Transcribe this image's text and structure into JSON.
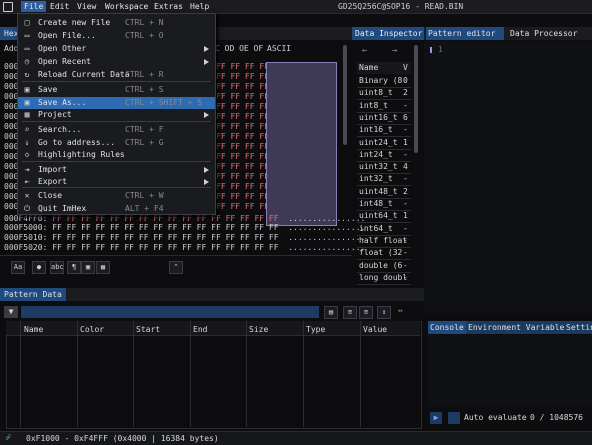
{
  "menubar": {
    "items": [
      "File",
      "Edit",
      "View",
      "Workspace",
      "Extras",
      "Help"
    ],
    "title": "GD25Q256C@SOP16 - READ.BIN"
  },
  "file_menu": [
    {
      "label": "Create new File",
      "shortcut": "CTRL + N",
      "icon": "file-new-icon"
    },
    {
      "label": "Open File...",
      "shortcut": "CTRL + O",
      "icon": "folder-open-icon"
    },
    {
      "label": "Open Other",
      "shortcut": "",
      "icon": "folder-icon",
      "submenu": true
    },
    {
      "label": "Open Recent",
      "shortcut": "",
      "icon": "clock-icon",
      "submenu": true
    },
    {
      "label": "Reload Current Data",
      "shortcut": "CTRL + R",
      "icon": "reload-icon"
    },
    {
      "label": "Save",
      "shortcut": "CTRL + S",
      "icon": "save-icon"
    },
    {
      "label": "Save As...",
      "shortcut": "CTRL + SHIFT + S",
      "icon": "save-as-icon"
    },
    {
      "label": "Project",
      "shortcut": "",
      "icon": "project-icon",
      "submenu": true
    },
    {
      "label": "Search...",
      "shortcut": "CTRL + F",
      "icon": "search-icon"
    },
    {
      "label": "Go to address...",
      "shortcut": "CTRL + G",
      "icon": "goto-icon"
    },
    {
      "label": "Highlighting Rules",
      "shortcut": "",
      "icon": "highlight-icon"
    },
    {
      "label": "Import",
      "shortcut": "",
      "icon": "import-icon",
      "submenu": true
    },
    {
      "label": "Export",
      "shortcut": "",
      "icon": "export-icon",
      "submenu": true
    },
    {
      "label": "Close",
      "shortcut": "CTRL + W",
      "icon": "close-icon"
    },
    {
      "label": "Quit ImHex",
      "shortcut": "ALT + F4",
      "icon": "power-icon"
    }
  ],
  "hex": {
    "tab_label": "Hex",
    "col_header_visible": "C OD OE OF",
    "ascii_header": "ASCII",
    "addr_label": "Add",
    "row_stubs": [
      "000",
      "000",
      "000",
      "000",
      "000",
      "000",
      "000",
      "000",
      "000",
      "000",
      "000",
      "000",
      "000",
      "000",
      "000"
    ],
    "tail_rows": [
      {
        "addr": "000F4FF0:",
        "bytes": "FF FF FF FF FF FF FF FF FF FF FF FF FF FF FF FF",
        "ascii": "................"
      },
      {
        "addr": "000F5000:",
        "bytes": "FF FF FF FF FF FF FF FF FF FF FF FF FF FF FF FF",
        "ascii": "................"
      },
      {
        "addr": "000F5010:",
        "bytes": "FF FF FF FF FF FF FF FF FF FF FF FF FF FF FF FF",
        "ascii": "................"
      },
      {
        "addr": "000F5020:",
        "bytes": "FF FF FF FF FF FF FF FF FF FF FF FF FF FF FF FF",
        "ascii": "................"
      }
    ],
    "visible_red": "FF FF FF FF",
    "footer_buttons": [
      "Aa",
      "abc"
    ]
  },
  "data_inspector": {
    "tab_label": "Data Inspector",
    "col_name": "Name",
    "col_value": "V",
    "rows": [
      {
        "name": "Binary (8",
        "val": "0"
      },
      {
        "name": "uint8_t",
        "val": "2"
      },
      {
        "name": "int8_t",
        "val": "-"
      },
      {
        "name": "uint16_t",
        "val": "6"
      },
      {
        "name": "int16_t",
        "val": "-"
      },
      {
        "name": "uint24_t",
        "val": "1"
      },
      {
        "name": "int24_t",
        "val": "-"
      },
      {
        "name": "uint32_t",
        "val": "4"
      },
      {
        "name": "int32_t",
        "val": "-"
      },
      {
        "name": "uint48_t",
        "val": "2"
      },
      {
        "name": "int48_t",
        "val": "-"
      },
      {
        "name": "uint64_t",
        "val": "1"
      },
      {
        "name": "int64_t",
        "val": "-"
      },
      {
        "name": "half float",
        "val": "-"
      },
      {
        "name": "float (32",
        "val": "-"
      },
      {
        "name": "double (6",
        "val": "-"
      },
      {
        "name": "long doubl",
        "val": "-"
      }
    ]
  },
  "pattern_editor": {
    "tab_label": "Pattern editor",
    "line_number": "1"
  },
  "data_processor": {
    "tab_label": "Data Processor"
  },
  "pattern_data": {
    "tab_label": "Pattern Data",
    "columns": [
      "Name",
      "Color",
      "Start",
      "End",
      "Size",
      "Type",
      "Value"
    ]
  },
  "console": {
    "tabs": [
      "Console",
      "Environment Variables",
      "Settin"
    ],
    "auto_evaluate": "Auto evaluate",
    "counter": "0 / 1048576"
  },
  "statusbar": {
    "text": "0xF1000 - 0xF4FFF (0x4000 | 16384 bytes)"
  },
  "colors": {
    "accent": "#2d6bb3",
    "tab_active": "#1f4a80",
    "red_bytes": "#e07070",
    "selection": "#3e3a55"
  }
}
